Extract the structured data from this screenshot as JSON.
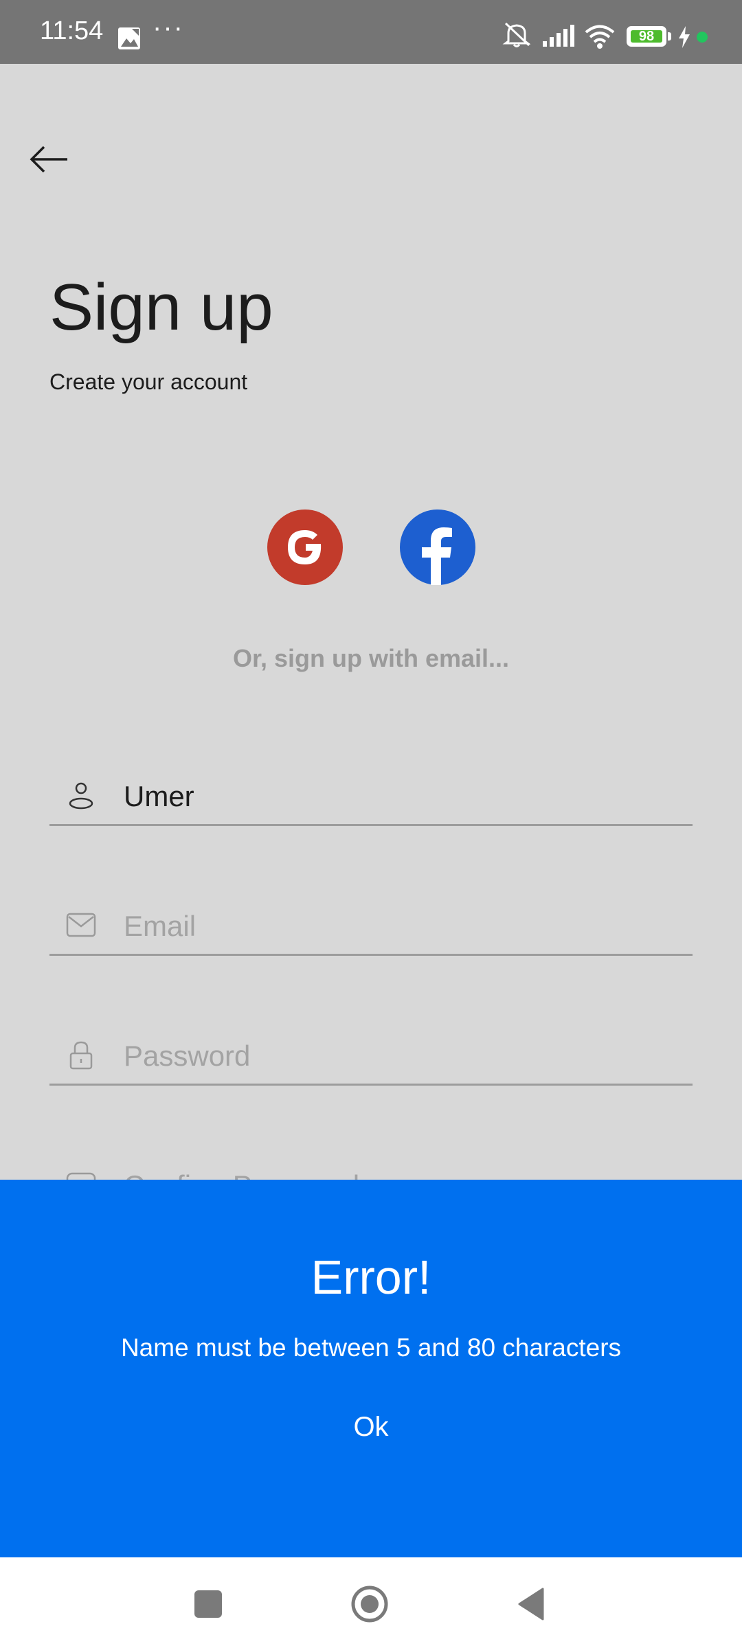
{
  "status_bar": {
    "time": "11:54",
    "dots": "···",
    "battery_level": "98",
    "icons": [
      "gallery-icon",
      "mute-icon",
      "signal-icon",
      "wifi-icon",
      "battery-icon",
      "charging-icon"
    ]
  },
  "header": {
    "back_icon": "arrow-left-icon",
    "title": "Sign up",
    "subtitle": "Create your account"
  },
  "social": {
    "google_letter": "G",
    "facebook_letter": "f",
    "google_color": "#c23b2b",
    "facebook_color": "#1d5fd0"
  },
  "divider_text": "Or, sign up with email...",
  "form": {
    "name": {
      "value": "Umer",
      "icon": "user-icon"
    },
    "email": {
      "placeholder": "Email",
      "icon": "mail-icon"
    },
    "password": {
      "placeholder": "Password",
      "icon": "lock-icon"
    },
    "confirm_password": {
      "placeholder": "Confirm Password",
      "icon": "dots-icon"
    }
  },
  "error_dialog": {
    "title": "Error!",
    "message": "Name must be between 5 and 80 characters",
    "ok_label": "Ok",
    "background": "#0070ef"
  },
  "nav_bar": {
    "icons": [
      "recents-icon",
      "home-icon",
      "back-icon"
    ]
  }
}
